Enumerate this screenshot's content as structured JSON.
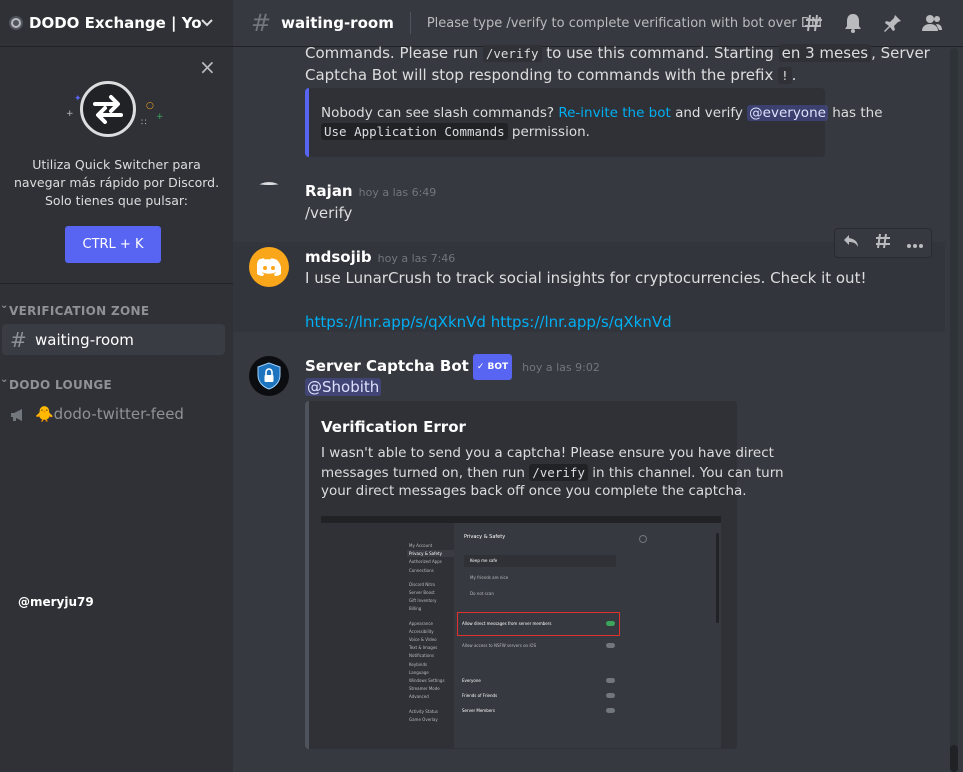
{
  "server": {
    "name": "DODO Exchange | Yo..."
  },
  "quick_switcher": {
    "text": "Utiliza Quick Switcher para navegar más rápido por Discord. Solo tienes que pulsar:",
    "shortcut": "CTRL + K"
  },
  "sidebar": {
    "categories": [
      {
        "label": "VERIFICATION ZONE",
        "channels": [
          {
            "label": "waiting-room",
            "active": true
          }
        ]
      },
      {
        "label": "DODO LOUNGE",
        "channels": [
          {
            "label": "🐥dodo-twitter-feed",
            "active": false
          }
        ]
      }
    ]
  },
  "watermark": "@meryju79",
  "topbar": {
    "channel": "waiting-room",
    "topic": "Please type /verify to complete verification with bot over DM"
  },
  "messages": {
    "prev": {
      "line1_a": "Commands. Please run ",
      "line1_code": "/verify",
      "line1_b": " to use this command. Starting ",
      "line1_hl": "en 3 meses",
      "line1_c": ", Server",
      "line2_a": "Captcha Bot will stop responding to commands with the prefix ",
      "line2_code": "!",
      "line2_b": ".",
      "embed_a": "Nobody can see slash commands? ",
      "embed_link": "Re-invite the bot",
      "embed_b": " and verify ",
      "embed_mention": "@everyone",
      "embed_c": " has the",
      "embed_code": "Use Application Commands",
      "embed_d": " permission."
    },
    "rajan": {
      "author": "Rajan",
      "time": "hoy a las 6:49",
      "text": "/verify"
    },
    "mdsojib": {
      "author": "mdsojib",
      "time": "hoy a las 7:46",
      "text": "I use LunarCrush to track social insights for cryptocurrencies. Check it out!",
      "link": "https://lnr.app/s/qXknVd https://lnr.app/s/qXknVd"
    },
    "bot": {
      "author": "Server Captcha Bot",
      "badge": "✓ BOT",
      "time": "hoy a las 9:02",
      "mention": "@Shobith",
      "embed_title": "Verification Error",
      "embed_line1": "I wasn't able to send you a captcha! Please ensure you have direct",
      "embed_line2_a": "messages turned on, then run ",
      "embed_line2_code": "/verify",
      "embed_line2_b": " in this channel. You can turn",
      "embed_line3": "your direct messages back off once you complete the captcha."
    }
  },
  "shot": {
    "title": "Privacy & Safety",
    "menu": [
      "My Account",
      "Privacy & Safety",
      "Authorized Apps",
      "Connections",
      "Discord Nitro",
      "Server Boost",
      "Gift Inventory",
      "Billing",
      "Appearance",
      "Accessibility",
      "Voice & Video",
      "Text & Images",
      "Notifications",
      "Keybinds",
      "Language",
      "Windows Settings",
      "Streamer Mode",
      "Advanced",
      "Activity Status",
      "Game Overlay"
    ],
    "options": [
      "Keep me safe",
      "My friends are nice",
      "Do not scan"
    ],
    "highlight": "Allow direct messages from server members",
    "nsfw": "Allow access to NSFW servers on iOS",
    "friend_req": [
      "Everyone",
      "Friends of Friends",
      "Server Members"
    ]
  },
  "colors": {
    "accent": "#5865f2",
    "link": "#00aff4",
    "bg": "#36393f",
    "sidebar": "#2f3136"
  }
}
